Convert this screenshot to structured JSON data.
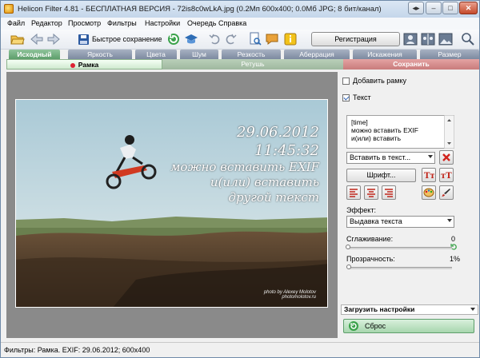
{
  "window": {
    "title": "Helicon Filter 4.81 - БЕСПЛАТНАЯ ВЕРСИЯ - 72is8c0wLkA.jpg (0.2Мп 600x400; 0.0Мб JPG; 8 бит/канал)",
    "buttons": {
      "extra": "◂▸",
      "minimize": "–",
      "maximize": "□",
      "close": "✕"
    }
  },
  "menu": [
    "Файл",
    "Редактор",
    "Просмотр",
    "Фильтры",
    "Настройки",
    "Очередь",
    "Справка"
  ],
  "toolbar": {
    "quick_save": "Быстрое сохранение",
    "register": "Регистрация"
  },
  "filter_tabs": [
    {
      "label": "Исходный",
      "active": true
    },
    {
      "label": "Яркость",
      "active": false
    },
    {
      "label": "Цвета",
      "active": false
    },
    {
      "label": "Шум",
      "active": false
    },
    {
      "label": "Резкость",
      "active": false
    },
    {
      "label": "Аберрация",
      "active": false
    },
    {
      "label": "Искажения",
      "active": false
    },
    {
      "label": "Размер",
      "active": false
    }
  ],
  "subtabs": [
    {
      "label": "Рамка",
      "kind": "ramka"
    },
    {
      "label": "Ретушь",
      "kind": "retush"
    },
    {
      "label": "Сохранить",
      "kind": "save"
    }
  ],
  "overlay": {
    "lines": [
      "29.06.2012",
      "11:45:32",
      "можно вставить EXIF",
      "и(или) вставить",
      "другой текст"
    ],
    "credit": [
      "photo by Alexey Molotov",
      "photomolotov.ru"
    ]
  },
  "panel": {
    "add_frame_label": "Добавить рамку",
    "add_frame_checked": false,
    "text_label": "Текст",
    "text_checked": true,
    "text_content": [
      "[time]",
      "можно вставить EXIF",
      "и(или) вставить"
    ],
    "insert_select": "Вставить в текст...",
    "font_button": "Шрифт...",
    "effect_label": "Эффект:",
    "effect_select": "Выдавка текста",
    "smoothing_label": "Сглаживание:",
    "smoothing_value": "0",
    "smoothing_level": 0,
    "transparency_label": "Прозрачность:",
    "transparency_value": "1%",
    "transparency_level": 0.01,
    "load_settings": "Загрузить настройки",
    "reset_button": "Сброс"
  },
  "status": "Фильтры: Рамка. EXIF: 29.06.2012; 600x400",
  "colors": {
    "tab_inactive": "#8793a8",
    "tab_active": "#6aa878",
    "retush": "#a9c2a9",
    "save": "#cf8585",
    "preview_bg": "#8a8a8a"
  }
}
